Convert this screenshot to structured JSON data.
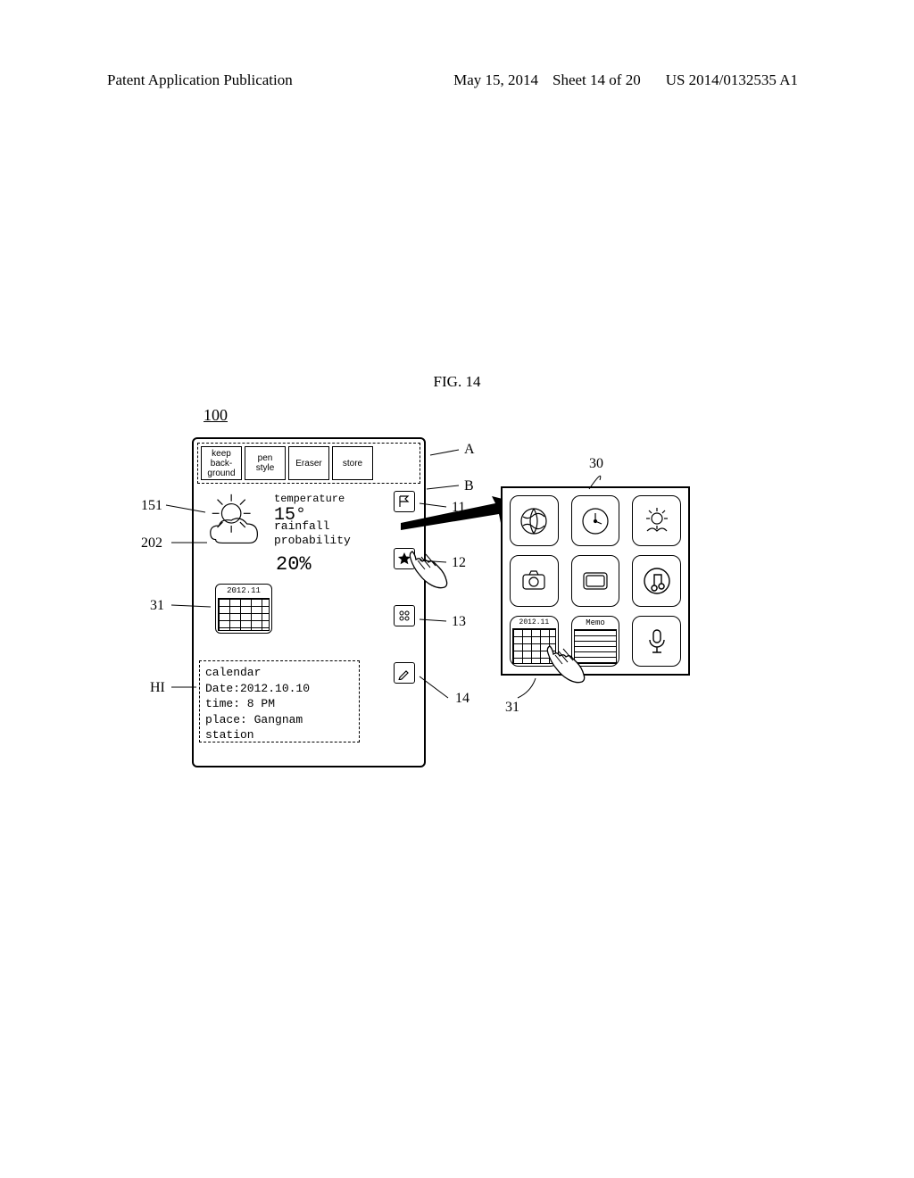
{
  "header": {
    "left": "Patent Application Publication",
    "date": "May 15, 2014",
    "sheet": "Sheet 14 of 20",
    "pubno": "US 2014/0132535 A1"
  },
  "figure_caption": "FIG. 14",
  "ref_100": "100",
  "leaders": {
    "l_151": "151",
    "l_202": "202",
    "l_31_left": "31",
    "l_HI": "HI",
    "l_A": "A",
    "l_B": "B",
    "l_11": "11",
    "l_12": "12",
    "l_13": "13",
    "l_14": "14",
    "l_30": "30",
    "l_31_right": "31"
  },
  "device1": {
    "toolbar": {
      "keep_bg": "keep\nback-\nground",
      "pen_style": "pen\nstyle",
      "eraser": "Eraser",
      "store": "store"
    },
    "weather": {
      "temp_label": "temperature",
      "temp_value": "15°",
      "rain_label": "rainfall\nprobability",
      "rain_value": "20%"
    },
    "calendar_title": "2012.11",
    "hidden_info": {
      "l1": "calendar",
      "l2": "Date:2012.10.10",
      "l3": "time: 8 PM",
      "l4": "place: Gangnam station"
    }
  },
  "device2": {
    "cal_title": "2012.11",
    "memo_title": "Memo"
  }
}
